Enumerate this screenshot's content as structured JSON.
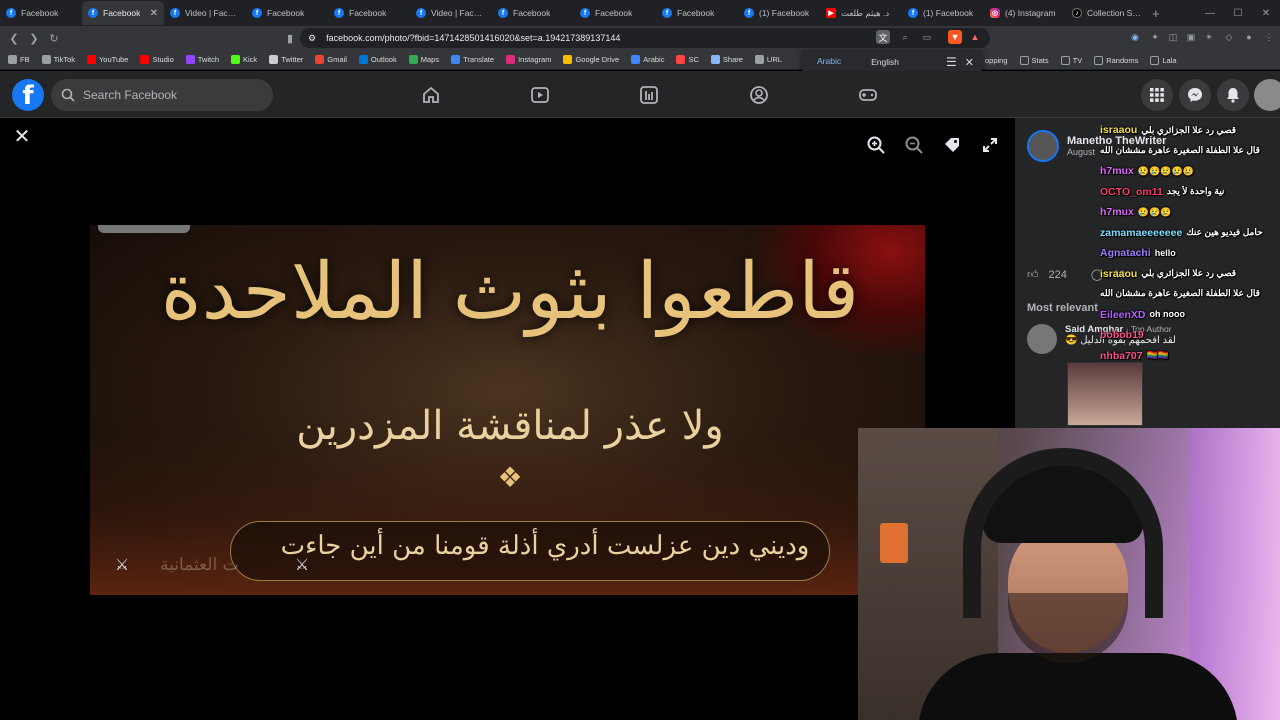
{
  "browser": {
    "tabs": [
      {
        "label": "Facebook",
        "icon": "facebook-icon",
        "active": false
      },
      {
        "label": "Facebook",
        "icon": "facebook-icon",
        "active": true
      },
      {
        "label": "Video | Facebo",
        "icon": "facebook-icon",
        "active": false
      },
      {
        "label": "Facebook",
        "icon": "facebook-icon",
        "active": false
      },
      {
        "label": "Facebook",
        "icon": "facebook-icon",
        "active": false
      },
      {
        "label": "Video | Facebo",
        "icon": "facebook-icon",
        "active": false
      },
      {
        "label": "Facebook",
        "icon": "facebook-icon",
        "active": false
      },
      {
        "label": "Facebook",
        "icon": "facebook-icon",
        "active": false
      },
      {
        "label": "Facebook",
        "icon": "facebook-icon",
        "active": false
      },
      {
        "label": "(1) Facebook",
        "icon": "facebook-icon",
        "active": false
      },
      {
        "label": "د. هيثم طلعت",
        "icon": "youtube-icon",
        "active": false
      },
      {
        "label": "(1) Facebook",
        "icon": "facebook-icon",
        "active": false
      },
      {
        "label": "(4) Instagram",
        "icon": "instagram-icon",
        "active": false
      },
      {
        "label": "Collection Stre",
        "icon": "tiktok-icon",
        "active": false
      }
    ],
    "url": "facebook.com/photo/?fbid=1471428501416020&set=a.194217389137144",
    "bookmarks": [
      "FB",
      "TikTok",
      "YouTube",
      "Studio",
      "Twitch",
      "Kick",
      "Twitter",
      "Gmail",
      "Outlook",
      "Maps",
      "Translate",
      "Instagram",
      "Google Drive",
      "Arabic",
      "SC",
      "Share",
      "URL"
    ],
    "bookmarks_right": [
      "opping",
      "Stats",
      "TV",
      "Randoms",
      "Lala"
    ],
    "translate": {
      "source": "Arabic",
      "target": "English"
    }
  },
  "facebook": {
    "search_placeholder": "Search Facebook",
    "post_author": "Manetho TheWriter",
    "post_date": "August",
    "like_count": "224",
    "comment_count": "39",
    "sort_label": "Most relevant",
    "comment_author": "Said Amghar",
    "comment_tag": "· Top Author",
    "comment_text": "لقد افحمهم بقوة الدليل 😎"
  },
  "photo_text": {
    "line1": "قاطعوا بثوث الملاحدة",
    "line2": "ولا عذر لمناقشة المزدرين",
    "line3": "وديني دين عزلست أدري أذلة قومنا من أين جاءت",
    "faded": "ت العثمانية"
  },
  "stream_chat": [
    {
      "user": "israaou",
      "text": "قصي رد علا الجزائري بلي",
      "color": "#f0e050"
    },
    {
      "user": "",
      "text": "قال علا الطفلة الصغيرة عاهرة مششان الله",
      "color": "#f0e050"
    },
    {
      "user": "h7mux",
      "text": "😢😢😢😢😢",
      "color": "#e066ff"
    },
    {
      "user": "OCTO_om11",
      "text": "نية واحدة لأ يجد",
      "color": "#ff3b6b"
    },
    {
      "user": "h7mux",
      "text": "😢😢😢",
      "color": "#e066ff"
    },
    {
      "user": "zamamaeeeeeee",
      "text": "حامل فيديو هين عنك",
      "color": "#7fdfff"
    },
    {
      "user": "Agnatachi",
      "text": "hello",
      "color": "#9d7dff"
    },
    {
      "user": "israaou",
      "text": "قصي رد علا الجزائري بلي",
      "color": "#f0e050"
    },
    {
      "user": "",
      "text": "قال علا الطفلة الصغيرة عاهرة مششان الله",
      "color": "#f0e050"
    },
    {
      "user": "EileenXD",
      "text": "oh nooo",
      "color": "#b65cff"
    },
    {
      "user": "bobob19",
      "text": "",
      "color": "#ff4f8b"
    },
    {
      "user": "nhba707",
      "text": "🏳️‍🌈🏳️‍🌈",
      "color": "#ff4f8b"
    }
  ]
}
